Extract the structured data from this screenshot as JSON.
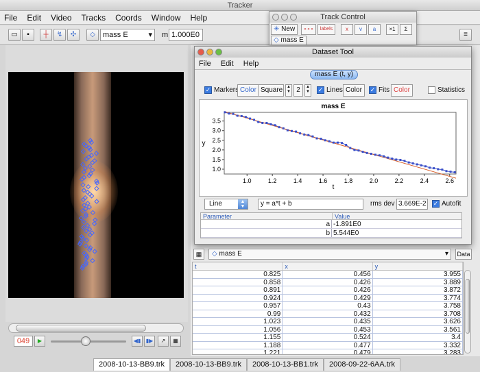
{
  "app": {
    "title": "Tracker",
    "menu": [
      "File",
      "Edit",
      "Video",
      "Tracks",
      "Coords",
      "Window",
      "Help"
    ]
  },
  "toolbar": {
    "track_select": "mass E",
    "mass_label": "m",
    "mass_value": "1.000E0"
  },
  "track_control": {
    "title": "Track Control",
    "new_label": "New",
    "labels_label": "labels",
    "track_item": "mass E"
  },
  "video": {
    "frame_number": "049"
  },
  "file_tabs": [
    "2008-10-13-BB9.trk",
    "2008-10-13-BB9.trk",
    "2008-10-13-BB1.trk",
    "2008-09-22-6AA.trk"
  ],
  "dataset_tool": {
    "title": "Dataset Tool",
    "menu": [
      "File",
      "Edit",
      "Help"
    ],
    "tab_label": "mass E (t, y)",
    "options": {
      "markers_label": "Markers",
      "color_label": "Color",
      "shape_value": "Square",
      "size_value": "2",
      "lines_label": "Lines",
      "fits_label": "Fits",
      "statistics_label": "Statistics"
    },
    "fit": {
      "type": "Line",
      "equation": "y = a*t + b",
      "rms_label": "rms dev",
      "rms_value": "3.669E-2",
      "autofit_label": "Autofit"
    },
    "params": {
      "header_param": "Parameter",
      "header_value": "Value",
      "rows": [
        {
          "name": "a",
          "value": "-1.891E0"
        },
        {
          "name": "b",
          "value": "5.544E0"
        }
      ]
    }
  },
  "chart_data": {
    "type": "scatter",
    "title": "mass E",
    "xlabel": "t",
    "ylabel": "y",
    "xlim": [
      0.82,
      2.65
    ],
    "ylim": [
      0.75,
      3.95
    ],
    "xticks": [
      "1.0",
      "1.2",
      "1.4",
      "1.6",
      "1.8",
      "2.0",
      "2.2",
      "2.4",
      "2.6"
    ],
    "yticks": [
      "1.0",
      "1.5",
      "2.0",
      "2.5",
      "3.0",
      "3.5"
    ],
    "fit": {
      "a": -1.891,
      "b": 5.544
    },
    "colors": {
      "markers": "#3a4fc8",
      "fit": "#d9602a"
    },
    "x": [
      0.825,
      0.858,
      0.891,
      0.924,
      0.957,
      0.99,
      1.023,
      1.056,
      1.089,
      1.122,
      1.155,
      1.188,
      1.221,
      1.254,
      1.287,
      1.32,
      1.353,
      1.386,
      1.419,
      1.452,
      1.485,
      1.518,
      1.551,
      1.584,
      1.617,
      1.65,
      1.683,
      1.716,
      1.749,
      1.782,
      1.815,
      1.848,
      1.881,
      1.914,
      1.947,
      1.98,
      2.013,
      2.046,
      2.079,
      2.112,
      2.145,
      2.178,
      2.211,
      2.244,
      2.277,
      2.31,
      2.343,
      2.376,
      2.409,
      2.442,
      2.475,
      2.508,
      2.541,
      2.574,
      2.607,
      2.64
    ],
    "y": [
      3.955,
      3.889,
      3.872,
      3.774,
      3.758,
      3.708,
      3.626,
      3.561,
      3.45,
      3.4,
      3.4,
      3.332,
      3.283,
      3.18,
      3.12,
      3.02,
      2.98,
      2.95,
      2.86,
      2.8,
      2.77,
      2.7,
      2.6,
      2.58,
      2.5,
      2.45,
      2.38,
      2.38,
      2.36,
      2.26,
      2.1,
      2.0,
      1.97,
      1.9,
      1.84,
      1.8,
      1.75,
      1.72,
      1.67,
      1.6,
      1.55,
      1.5,
      1.48,
      1.43,
      1.35,
      1.3,
      1.25,
      1.2,
      1.15,
      1.08,
      1.05,
      1.0,
      0.98,
      0.9,
      0.87,
      0.84
    ]
  },
  "data_table": {
    "track_select": "mass E",
    "data_button": "Data",
    "columns": [
      "t",
      "x",
      "y"
    ],
    "rows": [
      [
        "0.825",
        "0.456",
        "3.955"
      ],
      [
        "0.858",
        "0.426",
        "3.889"
      ],
      [
        "0.891",
        "0.426",
        "3.872"
      ],
      [
        "0.924",
        "0.429",
        "3.774"
      ],
      [
        "0.957",
        "0.43",
        "3.758"
      ],
      [
        "0.99",
        "0.432",
        "3.708"
      ],
      [
        "1.023",
        "0.435",
        "3.626"
      ],
      [
        "1.056",
        "0.453",
        "3.561"
      ],
      [
        "1.155",
        "0.524",
        "3.4"
      ],
      [
        "1.188",
        "0.477",
        "3.332"
      ],
      [
        "1.221",
        "0.479",
        "3.283"
      ]
    ]
  }
}
